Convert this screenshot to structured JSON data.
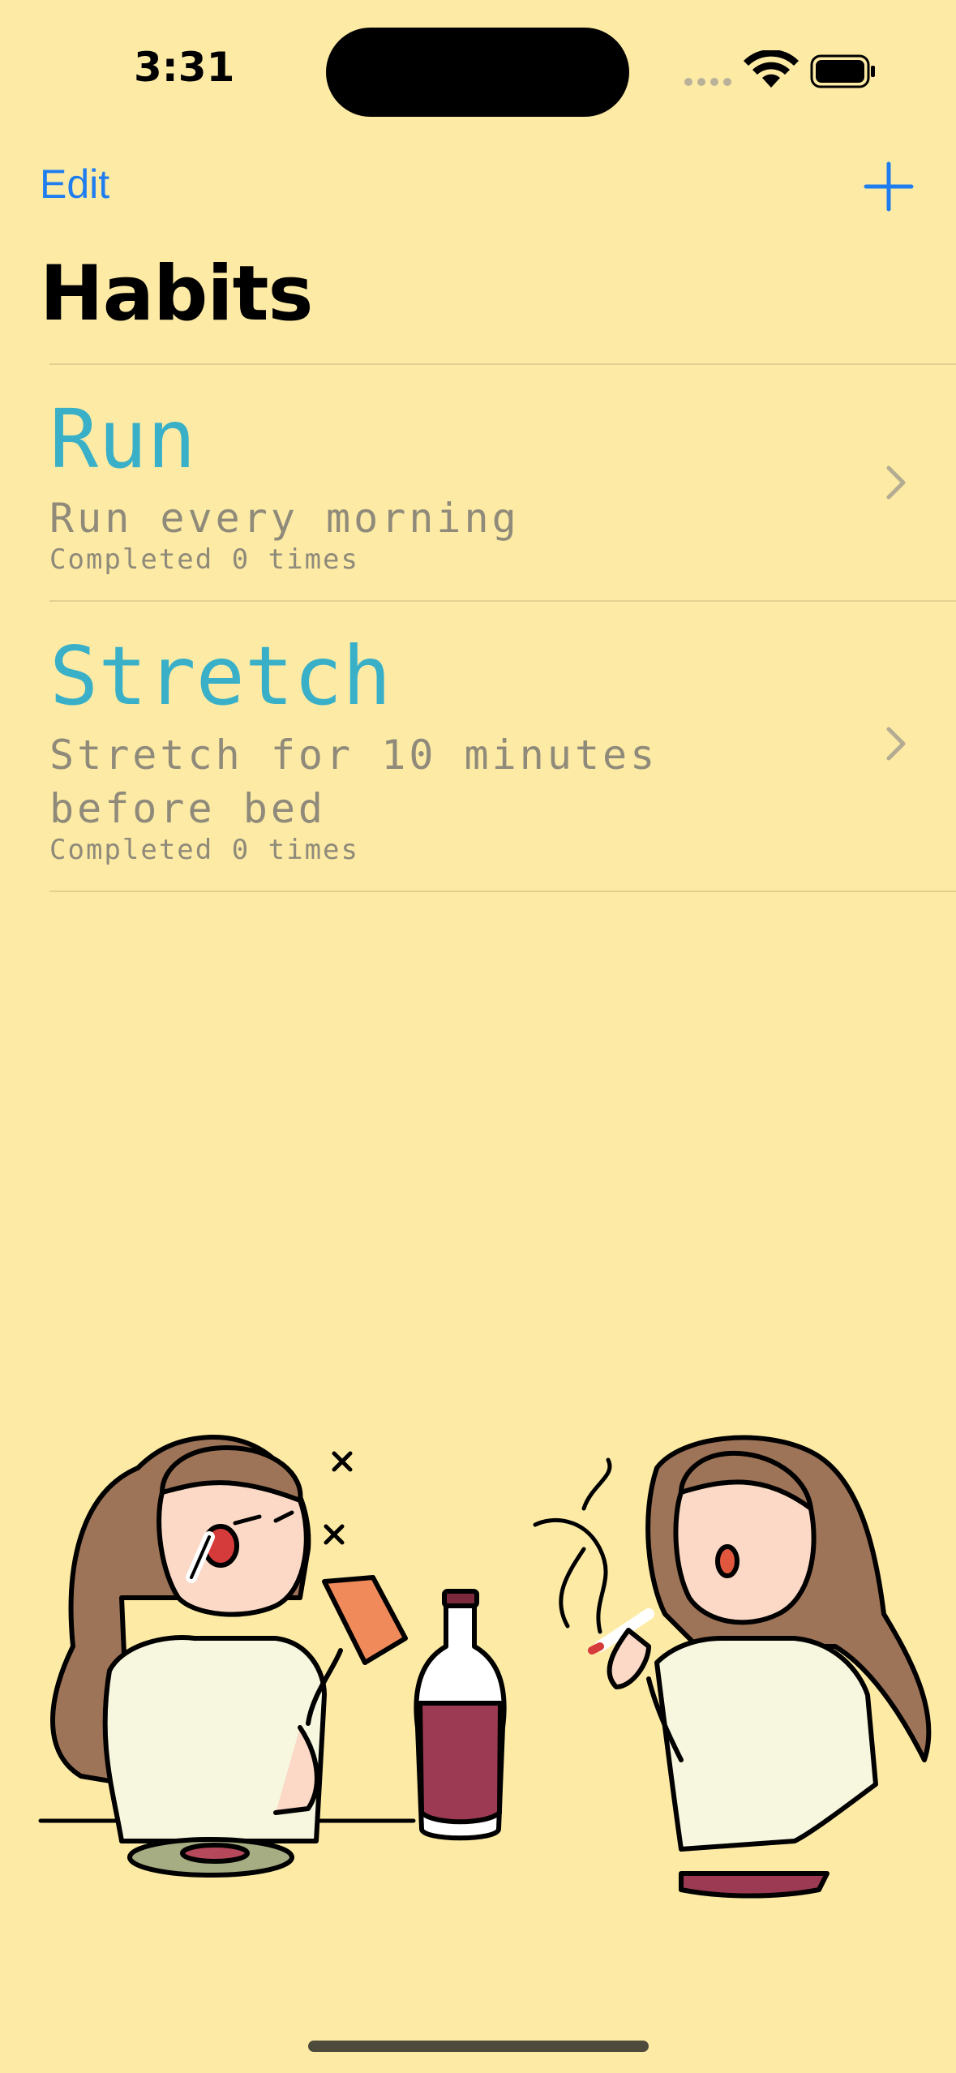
{
  "status_bar": {
    "time": "3:31"
  },
  "nav": {
    "edit_label": "Edit",
    "add_icon": "plus-icon"
  },
  "page": {
    "title": "Habits"
  },
  "habits": [
    {
      "name": "Run",
      "description": "Run every morning",
      "completed": "Completed 0 times"
    },
    {
      "name": "Stretch",
      "description": "Stretch for 10 minutes before bed",
      "completed": "Completed 0 times"
    }
  ],
  "colors": {
    "background": "#FDEBA5",
    "accent": "#1F7DEF",
    "habit_name": "#39B0C8",
    "secondary_text": "#8F8A7A"
  },
  "illustration": {
    "subject": "two-women-bad-habits-drinking-smoking"
  }
}
